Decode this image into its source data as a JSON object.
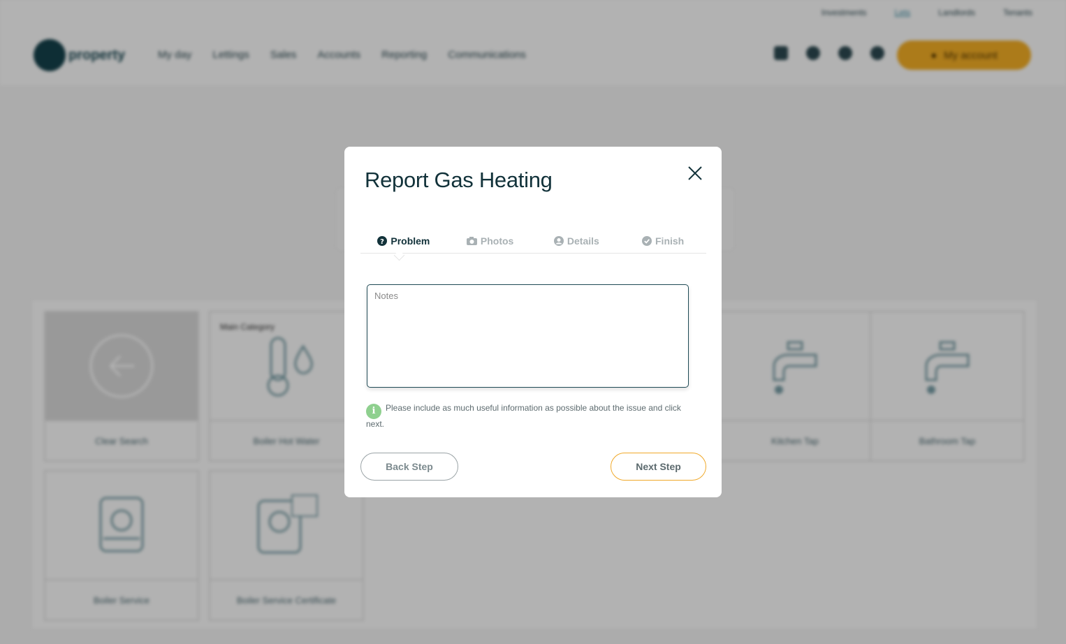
{
  "background": {
    "top_links": [
      "Investments",
      "Lets",
      "Landlords",
      "Tenants"
    ],
    "logo_text": "property",
    "nav_menu": [
      "My day",
      "Lettings",
      "Sales",
      "Accounts",
      "Reporting",
      "Communications"
    ],
    "my_account_label": "My account",
    "tiles": [
      {
        "caption": "Clear Search",
        "tag": ""
      },
      {
        "caption": "Boiler Hot Water",
        "tag": "Main Category"
      },
      {
        "caption": "Kitchen Tap",
        "tag": ""
      },
      {
        "caption": "Bathroom Tap",
        "tag": ""
      },
      {
        "caption": "Boiler Service",
        "tag": ""
      },
      {
        "caption": "Boiler Service Certificate",
        "tag": ""
      }
    ]
  },
  "modal": {
    "title": "Report Gas Heating",
    "steps": [
      {
        "label": "Problem",
        "icon": "question-circle-icon",
        "active": true
      },
      {
        "label": "Photos",
        "icon": "camera-icon",
        "active": false
      },
      {
        "label": "Details",
        "icon": "user-circle-icon",
        "active": false
      },
      {
        "label": "Finish",
        "icon": "check-circle-icon",
        "active": false
      }
    ],
    "notes_placeholder": "Notes",
    "notes_value": "",
    "hint_icon": "i",
    "hint_text": "Please include as much useful information as possible about the issue and click next.",
    "back_label": "Back Step",
    "next_label": "Next Step"
  },
  "colors": {
    "accent": "#f6b026",
    "primary_dark": "#12323a",
    "hint_green": "#8fd08f",
    "next_border": "#f0a92a"
  }
}
